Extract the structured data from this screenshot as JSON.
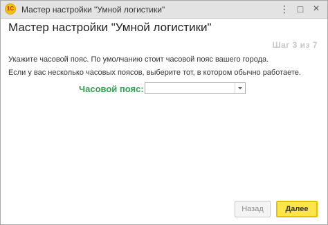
{
  "window": {
    "title": "Мастер настройки \"Умной логистики\"",
    "app_icon": "1С",
    "controls": {
      "menu": "⋮",
      "maximize": "□",
      "close": "×"
    }
  },
  "page": {
    "heading": "Мастер настройки \"Умной логистики\"",
    "step": "Шаг 3 из 7",
    "text_1": "Укажите часовой пояс. По умолчанию стоит часовой пояс вашего города.",
    "text_2": "Если у вас несколько часовых поясов, выберите тот, в котором обычно работаете."
  },
  "timezone": {
    "label": "Часовой пояс:",
    "value": ""
  },
  "buttons": {
    "back": "Назад",
    "next": "Далее"
  },
  "colors": {
    "label_green": "#2ea44f",
    "next_button_yellow": "#ffe54a"
  }
}
